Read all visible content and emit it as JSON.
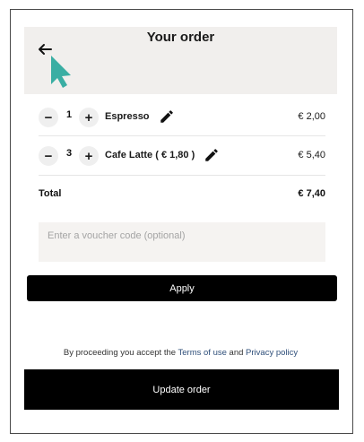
{
  "header": {
    "title": "Your order",
    "back_icon": "arrow-left-icon"
  },
  "items": [
    {
      "quantity": "1",
      "name": "Espresso",
      "price": "€ 2,00"
    },
    {
      "quantity": "3",
      "name": "Cafe Latte ( € 1,80 )",
      "price": "€ 5,40"
    }
  ],
  "controls": {
    "decrease_label": "−",
    "increase_label": "+",
    "edit_icon": "pencil-icon"
  },
  "total": {
    "label": "Total",
    "value": "€ 7,40"
  },
  "voucher": {
    "placeholder": "Enter a voucher code (optional)",
    "value": ""
  },
  "apply_button": {
    "label": "Apply"
  },
  "terms": {
    "prefix": "By proceeding you accept the",
    "terms_link": "Terms of use",
    "connector": "and",
    "privacy_link": "Privacy policy"
  },
  "update_button": {
    "label": "Update order"
  },
  "colors": {
    "header_bg": "#f1efed",
    "button_bg": "#000000",
    "cursor": "#3aaea3",
    "link": "#2f4f7a"
  }
}
